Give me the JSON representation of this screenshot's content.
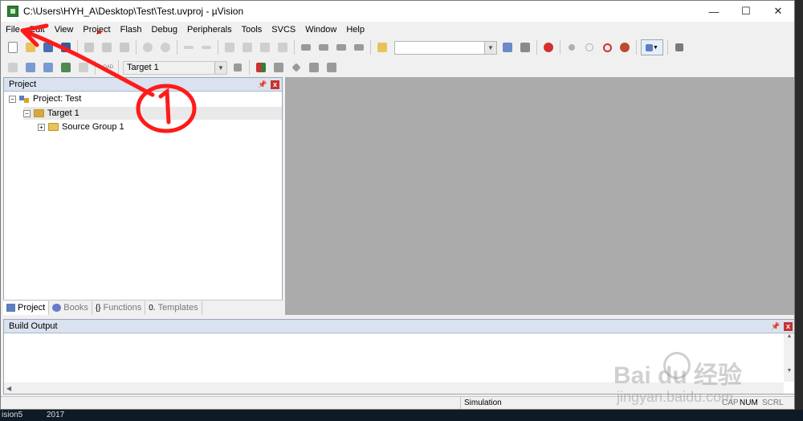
{
  "window": {
    "title": "C:\\Users\\HYH_A\\Desktop\\Test\\Test.uvproj - µVision",
    "controls": [
      "—",
      "☐",
      "✕"
    ]
  },
  "menu": [
    "File",
    "Edit",
    "View",
    "Project",
    "Flash",
    "Debug",
    "Peripherals",
    "Tools",
    "SVCS",
    "Window",
    "Help"
  ],
  "toolbar2": {
    "target_select": "Target 1",
    "load_label": "LOAD"
  },
  "project_panel": {
    "title": "Project",
    "tree": {
      "root": "Project: Test",
      "target": "Target 1",
      "group": "Source Group 1"
    },
    "tabs": [
      "Project",
      "Books",
      "Functions",
      "Templates"
    ]
  },
  "build_output": {
    "title": "Build Output"
  },
  "status": {
    "mode": "Simulation",
    "cap": "CAP",
    "num": "NUM",
    "scrl": "SCRL"
  },
  "taskbar": {
    "left_text": "ision5",
    "year_text": "2017"
  },
  "annotation": {
    "label": "①",
    "color": "#ff1a1a"
  },
  "watermark": {
    "brand": "Bai du 经验",
    "url": "jingyan.baidu.com"
  }
}
